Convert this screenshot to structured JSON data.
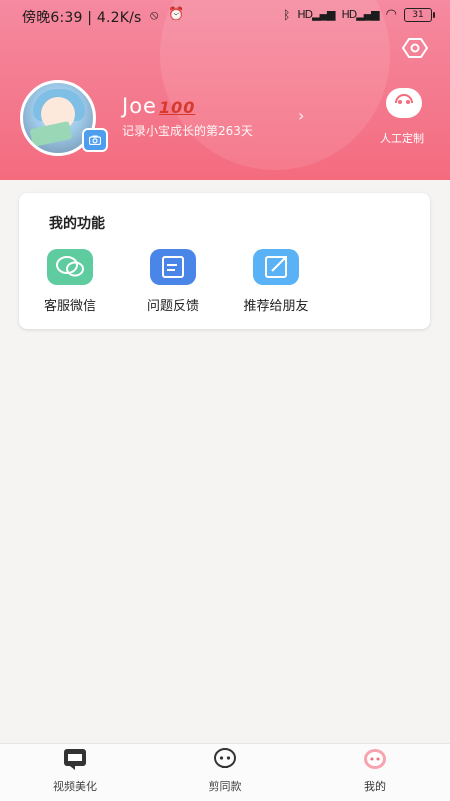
{
  "status_bar": {
    "time_speed": "傍晚6:39 | 4.2K/s",
    "battery": "31",
    "signal_1": "HD",
    "signal_2": "HD"
  },
  "colors": {
    "header_gradient_top": "#f58aa0",
    "header_gradient_bottom": "#f46b7e",
    "wechat_green": "#5fcca0",
    "feedback_blue": "#4a86e8",
    "share_blue": "#59b2f5",
    "active_tab": "#f46b7e"
  },
  "profile": {
    "username": "Joe",
    "badge": "100",
    "growth_text": "记录小宝成长的第263天",
    "custom_label": "人工定制"
  },
  "functions": {
    "title": "我的功能",
    "items": [
      {
        "label": "客服微信",
        "icon": "wechat-icon"
      },
      {
        "label": "问题反馈",
        "icon": "feedback-icon"
      },
      {
        "label": "推荐给朋友",
        "icon": "share-icon"
      }
    ]
  },
  "tabbar": {
    "tabs": [
      {
        "label": "视频美化",
        "icon": "video-beautify-icon"
      },
      {
        "label": "剪同款",
        "icon": "template-icon"
      },
      {
        "label": "我的",
        "icon": "profile-icon",
        "active": true
      }
    ]
  }
}
